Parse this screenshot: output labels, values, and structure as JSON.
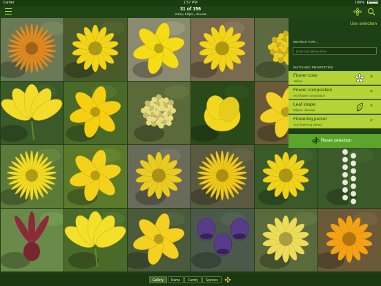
{
  "status_bar": {
    "carrier": "Carrier",
    "time": "1:57 PM",
    "battery": "100%"
  },
  "nav": {
    "title": "31 of 156",
    "subtitle": "Yellow, Elliptic, obovate",
    "menu_icon": "hamburger-menu-icon",
    "flower_icon": "flower-filter-icon",
    "search_icon": "search-icon"
  },
  "panel": {
    "use_selection": "Use selection",
    "search_header": "SEARCH FOR...",
    "search_placeholder": "Enter text please here",
    "matching_header": "MATCHING PROPERTIES",
    "properties": [
      {
        "label": "Flower color",
        "value": "Yellow",
        "thumb": "yellow-flower-thumbnail"
      },
      {
        "label": "Flower composition",
        "value": "Any flower composition",
        "thumb": ""
      },
      {
        "label": "Leaf shape",
        "value": "Elliptic, obovate",
        "thumb": "leaf-outline-icon"
      },
      {
        "label": "Flowering period",
        "value": "Any flowering period",
        "thumb": ""
      }
    ],
    "reset_label": "Reset selection",
    "reset_icon": "flower-reset-icon"
  },
  "tabs": [
    {
      "label": "Gallery",
      "active": true
    },
    {
      "label": "Name",
      "active": false
    },
    {
      "label": "Family",
      "active": false
    },
    {
      "label": "Species",
      "active": false
    }
  ],
  "tab_icon": "flower-tab-icon",
  "colors": {
    "accent": "#b6d94a",
    "panel_bg": "#1e4016",
    "row_bg": "#b5d336",
    "reset_bg": "#5ba62a",
    "nav_bg": "#1f4514"
  },
  "gallery": [
    {
      "color": "#e08a20",
      "bg": "#6b7a56",
      "type": "thin"
    },
    {
      "color": "#f2d51a",
      "bg": "#4a5a2a",
      "type": "ray"
    },
    {
      "color": "#f6dc14",
      "bg": "#8a8a70",
      "type": "broad"
    },
    {
      "color": "#f2d51a",
      "bg": "#7a6a50",
      "type": "ray"
    },
    {
      "color": "#eccf1e",
      "bg": "#5c6a40",
      "type": "ball"
    },
    {
      "color": "#f0d21a",
      "bg": "#6a8a4a",
      "type": "ray"
    },
    {
      "color": "#f4dc2a",
      "bg": "#3a5a2a",
      "type": "lily"
    },
    {
      "color": "#f5cf10",
      "bg": "#4a6a2a",
      "type": "broad"
    },
    {
      "color": "#e8dc80",
      "bg": "#5a6a3a",
      "type": "ball"
    },
    {
      "color": "#f2d81c",
      "bg": "#2a4a1a",
      "type": "cup"
    },
    {
      "color": "#f4d224",
      "bg": "#6a5a3a",
      "type": "broad"
    },
    {
      "color": "#f3cc1a",
      "bg": "#5a6a3a",
      "type": "lily"
    },
    {
      "color": "#f2dc20",
      "bg": "#5c7a3a",
      "type": "thin"
    },
    {
      "color": "#f5d21a",
      "bg": "#5a7a2a",
      "type": "broad"
    },
    {
      "color": "#eacb20",
      "bg": "#6a6a5a",
      "type": "ray"
    },
    {
      "color": "#f0c818",
      "bg": "#5a5a40",
      "type": "thin"
    },
    {
      "color": "#efd21a",
      "bg": "#3a5a2a",
      "type": "ray"
    },
    {
      "color": "#e8eada",
      "bg": "#3a5a2a",
      "type": "spike"
    },
    {
      "color": "#8b2b3a",
      "bg": "#6a8a4a",
      "type": "orchid"
    },
    {
      "color": "#f4e028",
      "bg": "#4a6a2a",
      "type": "lily"
    },
    {
      "color": "#f4d020",
      "bg": "#4a5a3a",
      "type": "broad"
    },
    {
      "color": "#5a3a8a",
      "bg": "#4a5a4a",
      "type": "bell"
    },
    {
      "color": "#ecdc58",
      "bg": "#5a6a3a",
      "type": "ray"
    },
    {
      "color": "#f4a214",
      "bg": "#6a5a3a",
      "type": "ray"
    }
  ]
}
